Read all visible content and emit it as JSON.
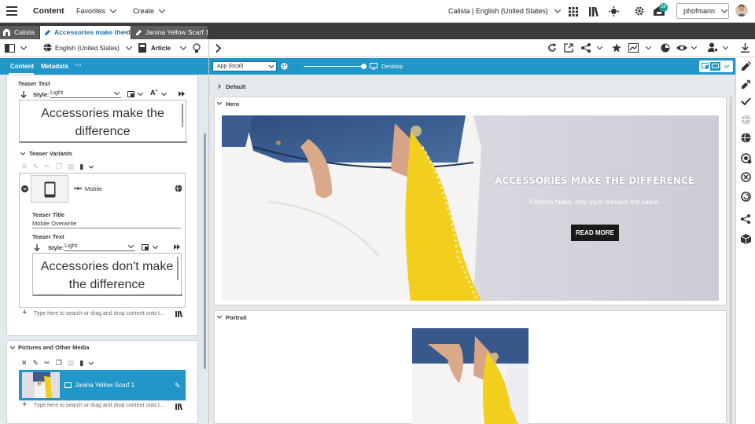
{
  "topbar": {
    "app_title": "Content",
    "favorites_label": "Favorites",
    "create_label": "Create",
    "site_locale": "Calista | English (United States)",
    "notification_count": "38",
    "user_name": "phofmann"
  },
  "tabs": [
    {
      "label": "Calista"
    },
    {
      "label": "Accessories make the di..."
    },
    {
      "label": "Janina Yellow Scarf 1"
    }
  ],
  "editor_toolbar": {
    "locale": "English (United States)",
    "doctype": "Article"
  },
  "panel_tabs": {
    "content": "Content",
    "metadata": "Metadata",
    "more": "···"
  },
  "teaser_text": {
    "header": "Teaser Text",
    "style_label": "Style:",
    "style_value": "Light",
    "line1": "Accessories make the",
    "line2": "difference"
  },
  "teaser_variants": {
    "header": "Teaser Variants",
    "device": "Mobile",
    "title_label": "Teaser Title",
    "title_value": "Mobile Overwrite",
    "text_label": "Teaser Text",
    "style_label": "Style:",
    "style_value": "Light",
    "line1": "Accessories don't make",
    "line2": "the difference",
    "search_placeholder": "Type here to search or drag and drop content onto t..."
  },
  "pictures": {
    "header": "Pictures and Other Media",
    "item_label": "Janina Yellow Scarf 1",
    "search_placeholder": "Type here to search or drag and drop content onto t..."
  },
  "preview": {
    "app_select": "App (local)",
    "device_label": "Desktop",
    "sections": {
      "default": "Default",
      "hero": "Hero",
      "portrait": "Portrait"
    },
    "hero_title": "ACCESSORIES MAKE THE DIFFERENCE",
    "hero_subtitle": "Fashion fades, only style remains the same.",
    "hero_button": "READ MORE"
  },
  "colors": {
    "accent": "#2196c8",
    "dark_tab": "#3c3c3c",
    "badge": "#1a9b8a"
  }
}
